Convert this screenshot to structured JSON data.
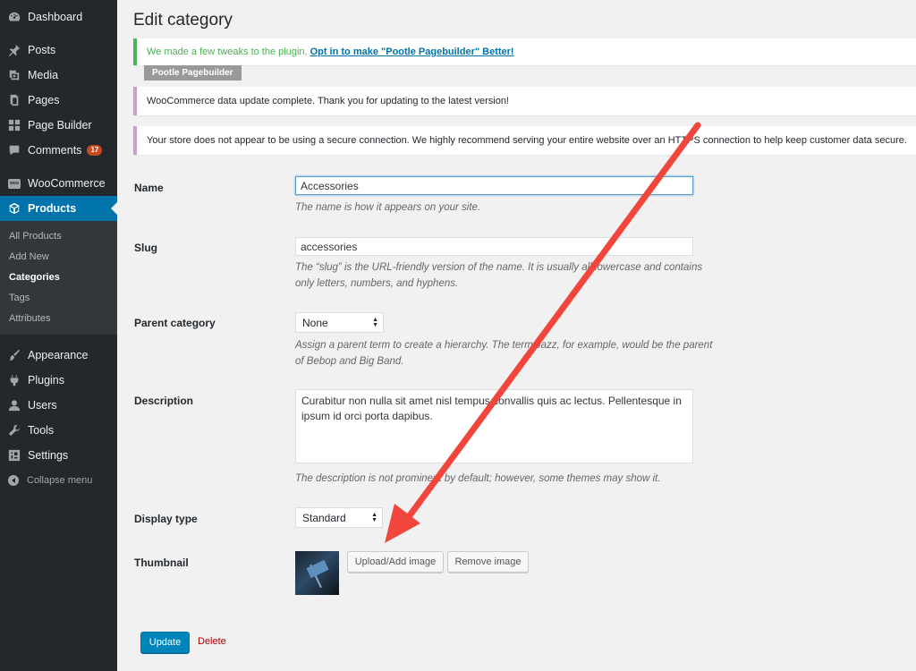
{
  "sidebar": {
    "items": [
      {
        "label": "Dashboard",
        "icon": "dashboard-icon"
      },
      {
        "label": "Posts",
        "icon": "pin-icon"
      },
      {
        "label": "Media",
        "icon": "media-icon"
      },
      {
        "label": "Pages",
        "icon": "pages-icon"
      },
      {
        "label": "Page Builder",
        "icon": "grid-icon"
      },
      {
        "label": "Comments",
        "icon": "comment-icon",
        "badge": "17"
      },
      {
        "label": "WooCommerce",
        "icon": "woo-icon",
        "icon_text": "woo"
      },
      {
        "label": "Products",
        "icon": "box-icon"
      },
      {
        "label": "Appearance",
        "icon": "brush-icon"
      },
      {
        "label": "Plugins",
        "icon": "plug-icon"
      },
      {
        "label": "Users",
        "icon": "user-icon"
      },
      {
        "label": "Tools",
        "icon": "wrench-icon"
      },
      {
        "label": "Settings",
        "icon": "settings-icon"
      },
      {
        "label": "Collapse menu",
        "icon": "collapse-icon"
      }
    ],
    "submenu": [
      "All Products",
      "Add New",
      "Categories",
      "Tags",
      "Attributes"
    ]
  },
  "page": {
    "title": "Edit category"
  },
  "notices": {
    "n1_text": "We made a few tweaks to the plugin,",
    "n1_link": "Opt in to make \"Pootle Pagebuilder\" Better!",
    "n1_tag": "Pootle Pagebuilder",
    "n2_text": "WooCommerce data update complete. Thank you for updating to the latest version!",
    "n3_text": "Your store does not appear to be using a secure connection. We highly recommend serving your entire website over an HTTPS connection to help keep customer data secure."
  },
  "form": {
    "name_label": "Name",
    "name_value": "Accessories",
    "name_help": "The name is how it appears on your site.",
    "slug_label": "Slug",
    "slug_value": "accessories",
    "slug_help": "The “slug” is the URL-friendly version of the name. It is usually all lowercase and contains only letters, numbers, and hyphens.",
    "parent_label": "Parent category",
    "parent_value": "None",
    "parent_help": "Assign a parent term to create a hierarchy. The term Jazz, for example, would be the parent of Bebop and Big Band.",
    "description_label": "Description",
    "description_value": "Curabitur non nulla sit amet nisl tempus convallis quis ac lectus. Pellentesque in ipsum id orci porta dapibus.",
    "description_help": "The description is not prominent by default; however, some themes may show it.",
    "display_label": "Display type",
    "display_value": "Standard",
    "thumbnail_label": "Thumbnail",
    "upload_label": "Upload/Add image",
    "remove_label": "Remove image",
    "update_label": "Update",
    "delete_label": "Delete"
  },
  "colors": {
    "sidebar_bg": "#23282d",
    "active_blue": "#0073aa",
    "annotation_arrow": "#f0463c"
  }
}
